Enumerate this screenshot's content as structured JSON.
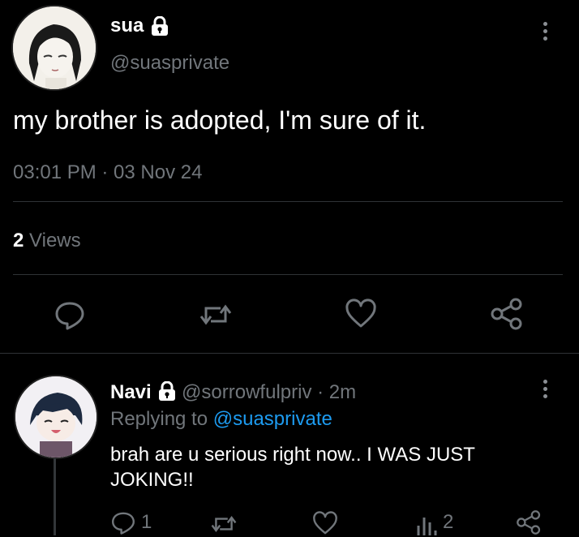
{
  "tweet": {
    "display_name": "sua",
    "handle": "@suasprivate",
    "text": "my brother is adopted, I'm sure of it.",
    "timestamp": "03:01 PM · 03 Nov 24",
    "views_count": "2",
    "views_label": "Views"
  },
  "reply": {
    "display_name": "Navi",
    "handle": "@sorrowfulpriv",
    "time_ago": "· 2m",
    "replying_prefix": "Replying to",
    "replying_to": "@suasprivate",
    "text": "brah are u serious right now.. I WAS JUST JOKING!!",
    "reply_count": "1",
    "views_count": "2"
  },
  "colors": {
    "background": "#000000",
    "text": "#e7e9ea",
    "muted": "#71767b",
    "link": "#1d9bf0",
    "divider": "#2f3336"
  },
  "icons": {
    "lock": "lock-icon",
    "menu": "more-vertical-icon",
    "reply": "reply-icon",
    "retweet": "retweet-icon",
    "like": "heart-icon",
    "share": "share-icon",
    "views": "views-icon"
  }
}
